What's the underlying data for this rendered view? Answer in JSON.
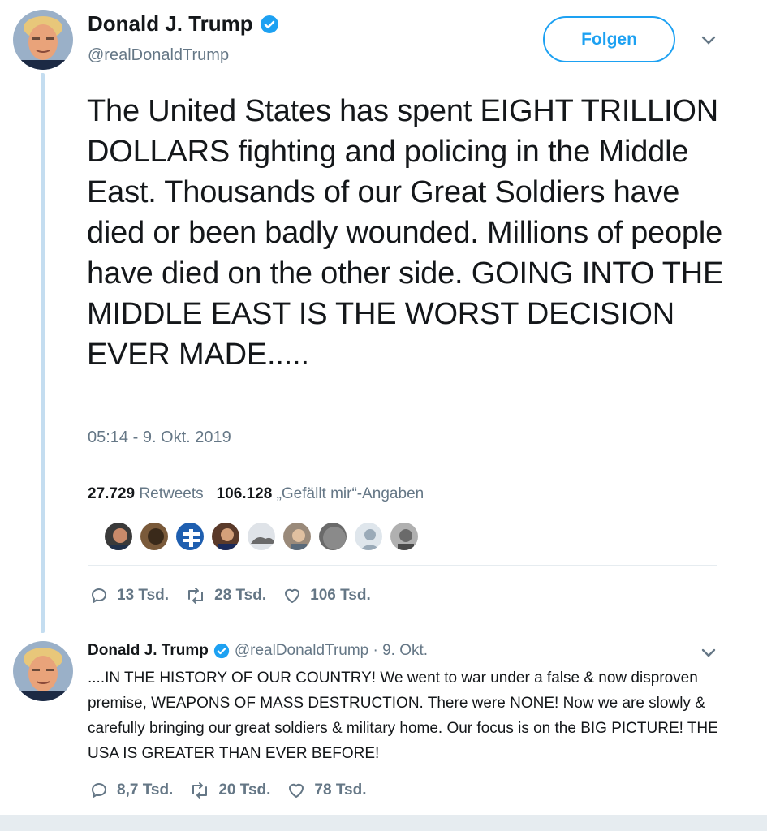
{
  "main_tweet": {
    "author_name": "Donald J. Trump",
    "author_handle": "@realDonaldTrump",
    "follow_label": "Folgen",
    "text": "The United States has spent EIGHT TRILLION DOLLARS fighting and policing in the Middle East. Thousands of our Great Soldiers have died or been badly wounded. Millions of people have died on the other side. GOING INTO THE MIDDLE EAST IS THE WORST DECISION EVER MADE.....",
    "timestamp": "05:14 - 9. Okt. 2019",
    "retweet_count": "27.729",
    "retweet_label": "Retweets",
    "like_count": "106.128",
    "like_label": "„Gefällt mir“-Angaben",
    "actions": {
      "replies": "13 Tsd.",
      "retweets": "28 Tsd.",
      "likes": "106 Tsd."
    }
  },
  "reply_tweet": {
    "author_name": "Donald J. Trump",
    "author_handle": "@realDonaldTrump · 9. Okt.",
    "text": "....IN THE HISTORY OF OUR COUNTRY! We went to war under a false & now disproven premise, WEAPONS OF MASS DESTRUCTION. There were NONE! Now we are slowly & carefully bringing our great soldiers & military home. Our focus is on the BIG PICTURE! THE USA IS GREATER THAN EVER BEFORE!",
    "actions": {
      "replies": "8,7 Tsd.",
      "retweets": "20 Tsd.",
      "likes": "78 Tsd."
    }
  },
  "colors": {
    "brand": "#1da1f2",
    "muted": "#657786",
    "text": "#14171a",
    "thread": "#c4ddf0"
  }
}
